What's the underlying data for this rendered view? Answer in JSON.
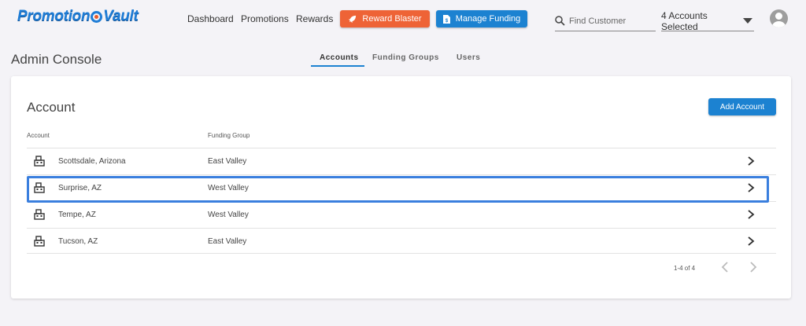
{
  "brand": {
    "name_part1": "Promotion",
    "name_part2": "Vault"
  },
  "nav": {
    "dashboard": "Dashboard",
    "promotions": "Promotions",
    "rewards": "Rewards"
  },
  "buttons": {
    "reward_blaster": "Reward Blaster",
    "manage_funding": "Manage Funding"
  },
  "search": {
    "placeholder": "Find Customer"
  },
  "account_selector": {
    "value": "4 Accounts Selected"
  },
  "page": {
    "title": "Admin Console"
  },
  "tabs": [
    {
      "label": "Accounts",
      "active": true
    },
    {
      "label": "Funding Groups",
      "active": false
    },
    {
      "label": "Users",
      "active": false
    }
  ],
  "card": {
    "title": "Account",
    "add_button": "Add Account"
  },
  "table": {
    "columns": [
      "Account",
      "Funding Group"
    ],
    "rows": [
      {
        "account": "Scottsdale, Arizona",
        "group": "East Valley"
      },
      {
        "account": "Surprise, AZ",
        "group": "West Valley"
      },
      {
        "account": "Tempe, AZ",
        "group": "West Valley"
      },
      {
        "account": "Tucson, AZ",
        "group": "East Valley"
      }
    ]
  },
  "pagination": {
    "range": "1-4 of 4"
  },
  "colors": {
    "primary": "#1c82d1",
    "accent": "#ee6336",
    "highlight": "#3a7fde"
  }
}
